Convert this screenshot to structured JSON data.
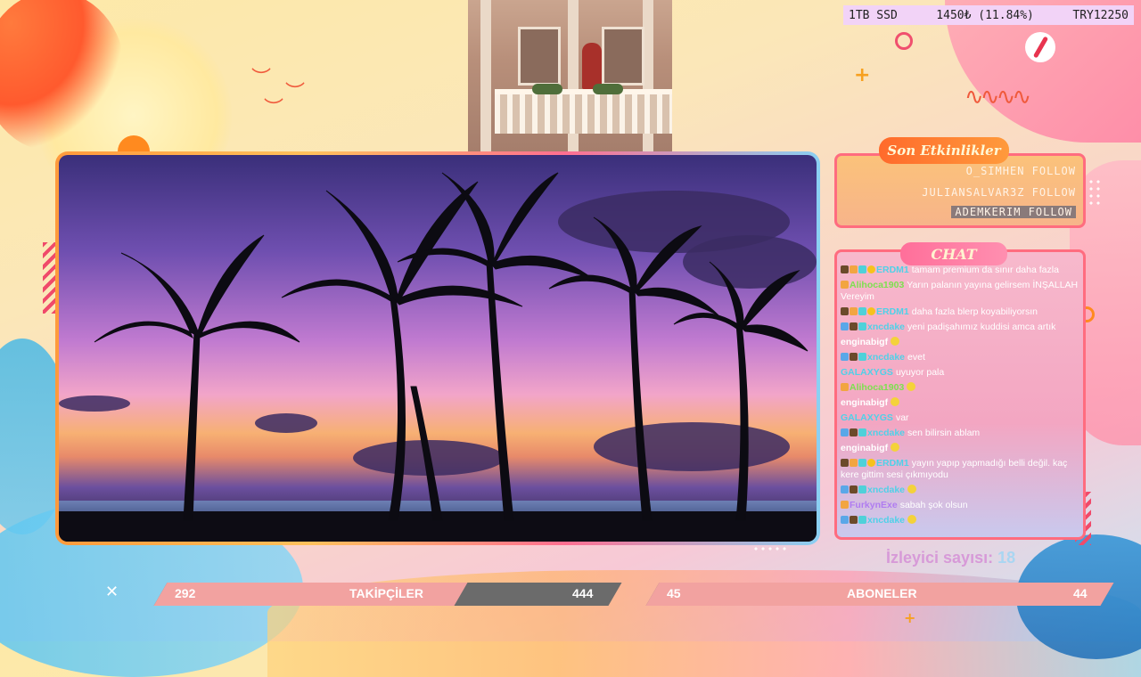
{
  "stats": {
    "storage": "1TB SSD",
    "amount": "1450₺ (11.84%)",
    "goal": "TRY12250"
  },
  "events": {
    "title": "Son Etkinlikler",
    "items": [
      "O_SIMHEN FOLLOW",
      "JULIANSALVAR3Z FOLLOW",
      "ADEMKERIM FOLLOW"
    ]
  },
  "chat": {
    "title": "CHAT",
    "messages": [
      {
        "user": "ERDM1",
        "color": "#4fd1e8",
        "badges": [
          "b1",
          "b2",
          "b3",
          "b4"
        ],
        "text": "tamam premium da sınır daha fazla"
      },
      {
        "user": "Alihoca1903",
        "color": "#7de04f",
        "badges": [
          "b2"
        ],
        "text": "Yarın palanın yayına gelirsem İNŞALLAH Vereyim"
      },
      {
        "user": "ERDM1",
        "color": "#4fd1e8",
        "badges": [
          "b1",
          "b2",
          "b3",
          "b4"
        ],
        "text": "daha fazla blerp koyabiliyorsın"
      },
      {
        "user": "xncdake",
        "color": "#4fd1e8",
        "badges": [
          "b5",
          "b1",
          "b3"
        ],
        "text": "yeni padişahımız kuddisi amca artık"
      },
      {
        "user": "enginabigf",
        "color": "#ffffff",
        "badges": [],
        "text": "",
        "emote": true
      },
      {
        "user": "xncdake",
        "color": "#4fd1e8",
        "badges": [
          "b5",
          "b1",
          "b3"
        ],
        "text": "evet"
      },
      {
        "user": "GALAXYGS",
        "color": "#4fd1e8",
        "badges": [],
        "text": "uyuyor pala"
      },
      {
        "user": "Alihoca1903",
        "color": "#7de04f",
        "badges": [
          "b2"
        ],
        "text": "",
        "emote": true
      },
      {
        "user": "enginabigf",
        "color": "#ffffff",
        "badges": [],
        "text": "",
        "emote": true
      },
      {
        "user": "GALAXYGS",
        "color": "#4fd1e8",
        "badges": [],
        "text": "var"
      },
      {
        "user": "xncdake",
        "color": "#4fd1e8",
        "badges": [
          "b5",
          "b1",
          "b3"
        ],
        "text": "sen bilirsin ablam"
      },
      {
        "user": "enginabigf",
        "color": "#ffffff",
        "badges": [],
        "text": "",
        "emote": true
      },
      {
        "user": "ERDM1",
        "color": "#4fd1e8",
        "badges": [
          "b1",
          "b2",
          "b3",
          "b4"
        ],
        "text": "yayın yapıp yapmadığı belli değil. kaç kere gittim sesi çıkmıyodu"
      },
      {
        "user": "xncdake",
        "color": "#4fd1e8",
        "badges": [
          "b5",
          "b1",
          "b3"
        ],
        "text": "",
        "emote": true
      },
      {
        "user": "FurkynExe",
        "color": "#b07cf0",
        "badges": [
          "b2"
        ],
        "text": "sabah şok olsun"
      },
      {
        "user": "xncdake",
        "color": "#4fd1e8",
        "badges": [
          "b5",
          "b1",
          "b3"
        ],
        "text": "",
        "emote": true
      }
    ]
  },
  "viewers": {
    "label": "İzleyici sayısı:",
    "count": "18"
  },
  "followers": {
    "current": "292",
    "label": "TAKİPÇİLER",
    "goal": "444",
    "progress": 0.66
  },
  "subscribers": {
    "current": "45",
    "label": "ABONELER",
    "goal": "44",
    "progress": 1.0
  },
  "colors": {
    "accent": "#ff6c7f",
    "bar_fill": "#f2a2a0",
    "bar_dark": "#6b6b6b"
  }
}
